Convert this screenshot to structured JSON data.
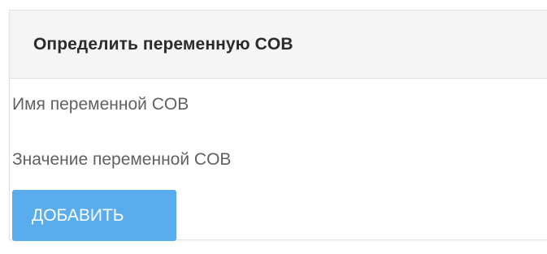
{
  "panel": {
    "title": "Определить переменную COB"
  },
  "form": {
    "name_label": "Имя переменной COB",
    "value_label": "Значение переменной COB",
    "add_button_label": "ДОБАВИТЬ"
  },
  "colors": {
    "button_bg": "#5aadec",
    "header_bg": "#f5f5f5",
    "label_text": "#616161"
  }
}
